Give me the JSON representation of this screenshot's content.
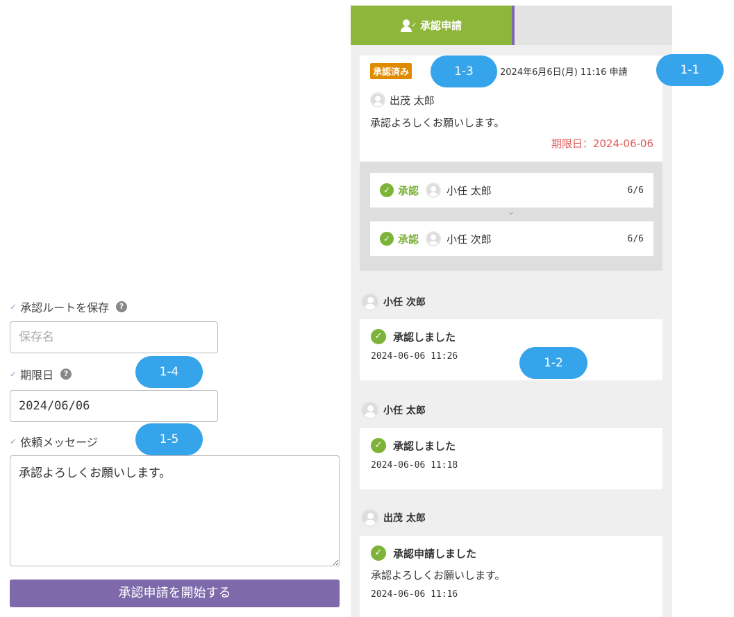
{
  "form": {
    "save_route_label": "承認ルートを保存",
    "save_name_placeholder": "保存名",
    "deadline_label": "期限日",
    "deadline_value": "2024/06/06",
    "message_label": "依頼メッセージ",
    "message_value": "承認よろしくお願いします。",
    "start_button": "承認申請を開始する",
    "check_glyph": "✓",
    "help_glyph": "?"
  },
  "panel": {
    "tab_active_label": "承認申請",
    "request": {
      "status": "承認済み",
      "applied_at": "2024年6月6日(月) 11:16 申請",
      "requester": "出茂 太郎",
      "message": "承認よろしくお願いします。",
      "deadline": "期限日：2024-06-06"
    },
    "steps": [
      {
        "status": "承認",
        "approver": "小任 太郎",
        "date": "6/6"
      },
      {
        "status": "承認",
        "approver": "小任 次郎",
        "date": "6/6"
      }
    ],
    "chevron": "⌄",
    "history": [
      {
        "user": "小任 次郎",
        "action": "承認しました",
        "message": "",
        "timestamp": "2024-06-06 11:26"
      },
      {
        "user": "小任 太郎",
        "action": "承認しました",
        "message": "",
        "timestamp": "2024-06-06 11:18"
      },
      {
        "user": "出茂 太郎",
        "action": "承認申請しました",
        "message": "承認よろしくお願いします。",
        "timestamp": "2024-06-06 11:16"
      }
    ]
  },
  "callouts": [
    "1-1",
    "1-2",
    "1-3",
    "1-4",
    "1-5"
  ],
  "colors": {
    "tab_active": "#8db63a",
    "accent_purple": "#7e6aab",
    "approved_green": "#7db339",
    "status_badge": "#e08a00",
    "deadline_red": "#e05a5a",
    "callout_blue": "#36a4ea"
  }
}
